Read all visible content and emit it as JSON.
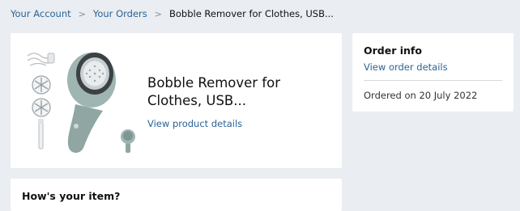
{
  "breadcrumb": {
    "account": "Your Account",
    "separator_1": ">",
    "orders": "Your Orders",
    "separator_2": ">",
    "current": "Bobble Remover for Clothes, USB..."
  },
  "product": {
    "title": "Bobble Remover for Clothes, USB...",
    "details_link": "View product details",
    "image_icon": "bobble-remover-product-image"
  },
  "order_info": {
    "title": "Order info",
    "details_link": "View order details",
    "ordered_on": "Ordered on 20 July 2022"
  },
  "review": {
    "heading": "How's your item?"
  },
  "colors": {
    "background": "#eaedf1",
    "card": "#ffffff",
    "link": "#2a6496",
    "text": "#0f1111",
    "product_body": "#8fa6a3"
  }
}
